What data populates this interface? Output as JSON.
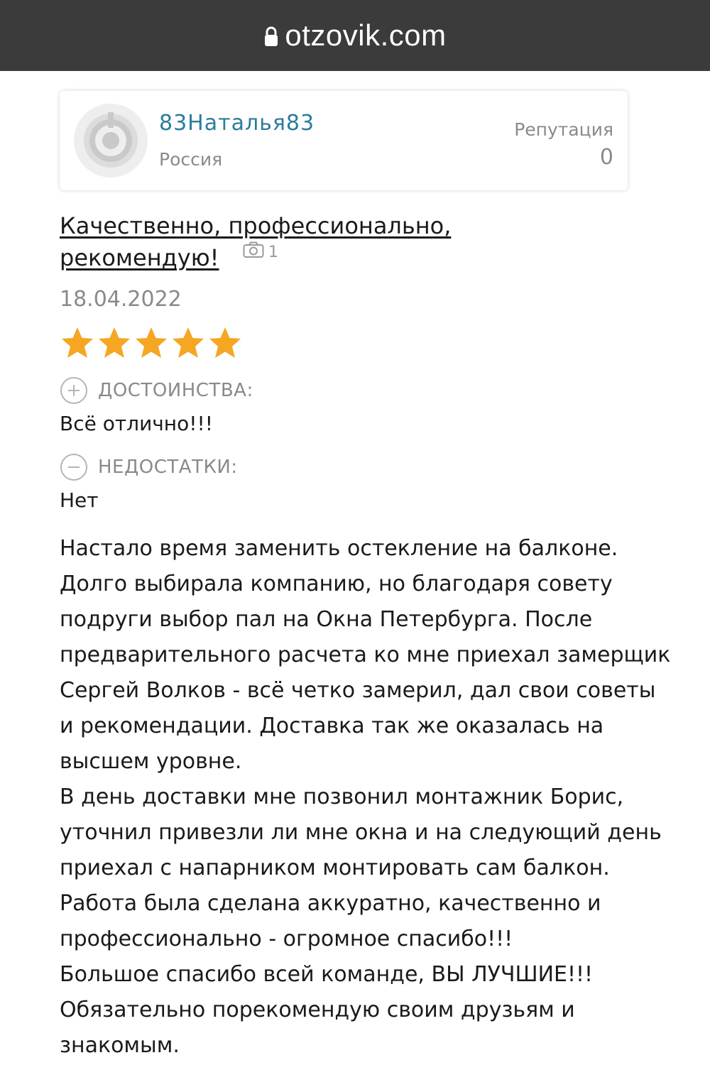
{
  "browser": {
    "url": "otzovik.com",
    "lock_icon": "lock-icon"
  },
  "user": {
    "name": "83Наталья83",
    "country": "Россия",
    "reputation_label": "Репутация",
    "reputation_value": "0",
    "avatar_icon": "default-avatar-icon"
  },
  "review": {
    "title_line1": "Качественно, профессионально,",
    "title_line2": "рекомендую!",
    "photo_count": "1",
    "date": "18.04.2022",
    "rating": 5,
    "rating_max": 5,
    "star_color": "#f5a623",
    "pros_label": "ДОСТОИНСТВА:",
    "pros_text": "Всё отлично!!!",
    "cons_label": "НЕДОСТАТКИ:",
    "cons_text": "Нет",
    "body_lines": [
      "Настало время заменить остекление на балконе.",
      "Долго выбирала компанию, но благодаря совету",
      "подруги выбор пал на Окна Петербурга. После",
      "предварительного расчета ко мне приехал замерщик",
      "Сергей Волков - всё четко замерил, дал свои советы",
      "и рекомендации. Доставка так же оказалась на",
      "высшем уровне.",
      "В день доставки мне позвонил монтажник Борис,",
      "уточнил привезли ли мне окна и на следующий день",
      "приехал с напарником монтировать сам балкон.",
      "Работа была сделана аккуратно, качественно и",
      "профессионально - огромное спасибо!!!",
      "Большое спасибо всей команде, ВЫ ЛУЧШИЕ!!!",
      "Обязательно порекомендую своим друзьям и",
      "знакомым."
    ]
  },
  "colors": {
    "topbar": "#3b3b3b",
    "username": "#2c7c9c",
    "muted": "#8a8a8a"
  }
}
